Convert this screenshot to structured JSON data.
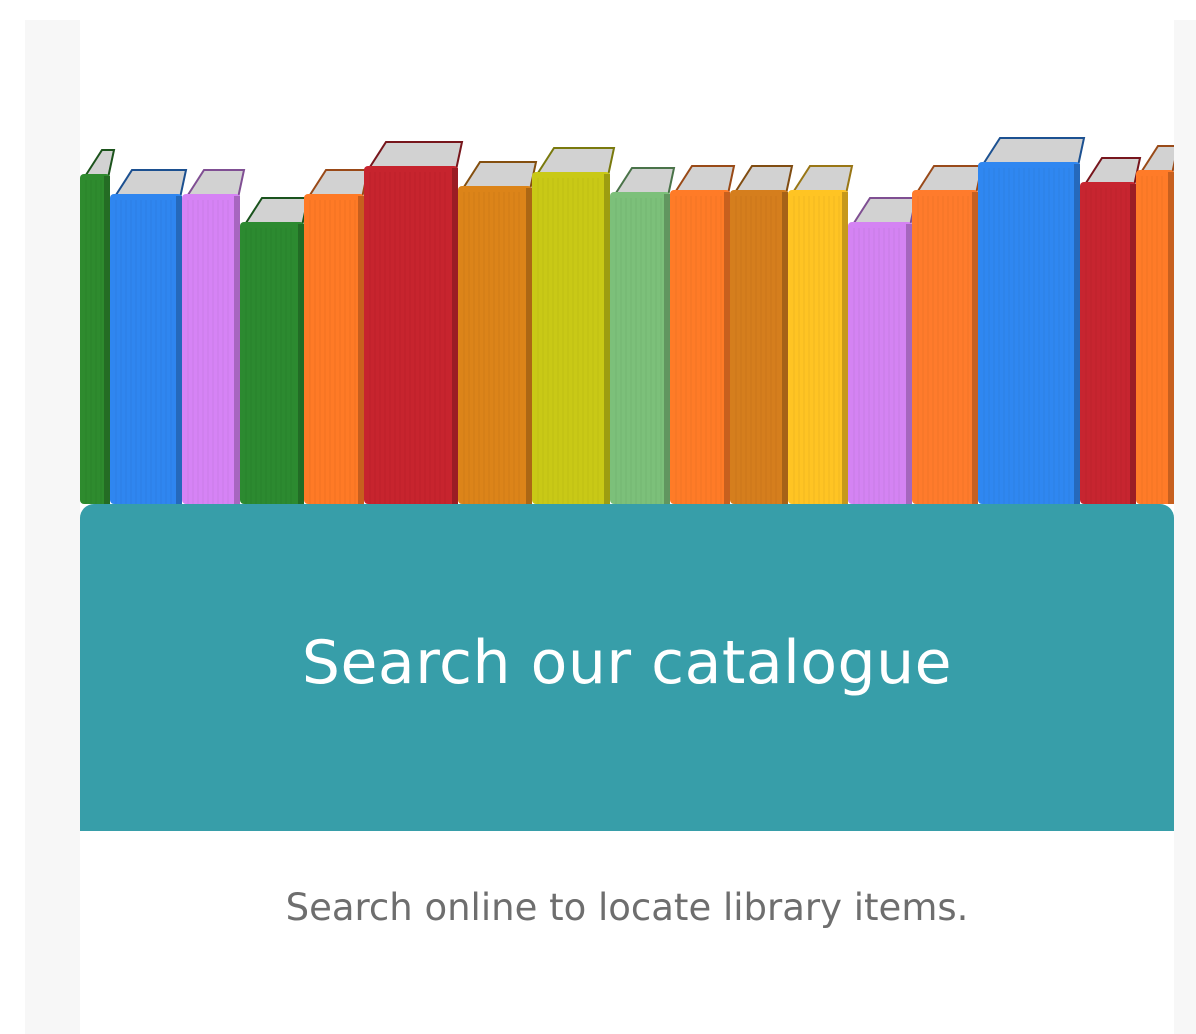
{
  "card": {
    "image_alt": "colorful-books-shelf-icon",
    "banner": {
      "title": "Search our catalogue",
      "color": "#379ea9"
    },
    "description": "Search online to locate library items.",
    "description_color": "#6e6e6e"
  },
  "colors": {
    "books": [
      "#2e8b2e",
      "#2f86f0",
      "#d683f5",
      "#2c8a30",
      "#ff7a26",
      "#c7242e",
      "#dc8419",
      "#c9c916",
      "#7cc07a",
      "#ff7b27",
      "#d57e1d",
      "#ffc423",
      "#d483f3",
      "#ff7b2c",
      "#2f87f1",
      "#c72530",
      "#ff7b28"
    ]
  }
}
